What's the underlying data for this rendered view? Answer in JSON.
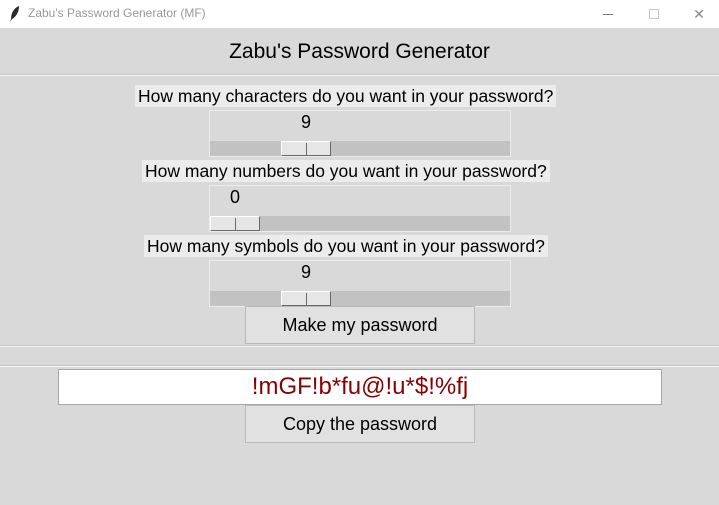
{
  "window": {
    "title": "Zabu's Password Generator (MF)",
    "close_glyph": "✕"
  },
  "app": {
    "heading": "Zabu's Password Generator"
  },
  "characters": {
    "label": "How many characters do you want in your password?",
    "value": "9",
    "level": 0.25
  },
  "numbers": {
    "label": "How many numbers do you want in your password?",
    "value": "0",
    "level": 0.0
  },
  "symbols": {
    "label": "How many symbols do you want in your password?",
    "value": "9",
    "level": 0.25
  },
  "make_button": {
    "label": "Make my password"
  },
  "password": {
    "value": "!mGF!b*fu@!u*$!%fj",
    "color": "#8b0000"
  },
  "copy_button": {
    "label": "Copy the password"
  }
}
